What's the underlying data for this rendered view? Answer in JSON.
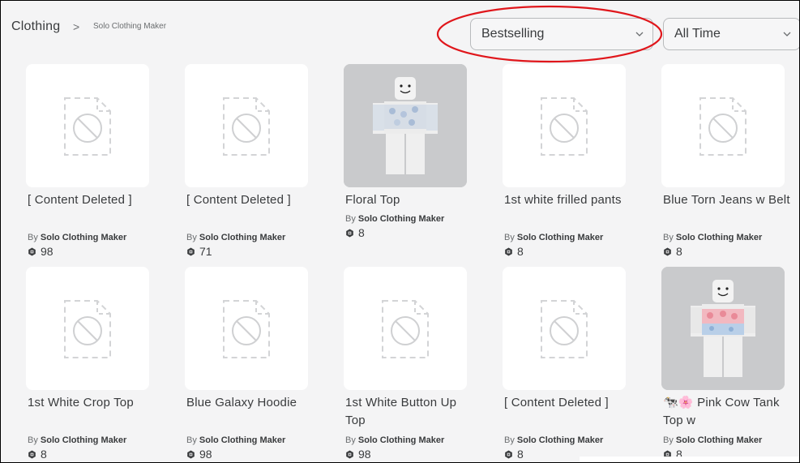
{
  "breadcrumb": {
    "category": "Clothing",
    "chevron": ">",
    "creator": "Solo Clothing Maker"
  },
  "filters": {
    "sort": {
      "value": "Bestselling",
      "highlighted": true
    },
    "time": {
      "value": "All Time"
    }
  },
  "items": [
    {
      "title": "[ Content Deleted ]",
      "creator_prefix": "By",
      "creator": "Solo Clothing Maker",
      "price": "98",
      "thumb": "deleted"
    },
    {
      "title": "[ Content Deleted ]",
      "creator_prefix": "By",
      "creator": "Solo Clothing Maker",
      "price": "71",
      "thumb": "deleted"
    },
    {
      "title": "Floral Top",
      "creator_prefix": "By",
      "creator": "Solo Clothing Maker",
      "price": "8",
      "thumb": "avatar-floral"
    },
    {
      "title": "1st white frilled pants",
      "creator_prefix": "By",
      "creator": "Solo Clothing Maker",
      "price": "8",
      "thumb": "deleted"
    },
    {
      "title": "Blue Torn Jeans w Belt",
      "creator_prefix": "By",
      "creator": "Solo Clothing Maker",
      "price": "8",
      "thumb": "deleted"
    },
    {
      "title": "1st White Crop Top",
      "creator_prefix": "By",
      "creator": "Solo Clothing Maker",
      "price": "8",
      "thumb": "deleted"
    },
    {
      "title": "Blue Galaxy Hoodie",
      "creator_prefix": "By",
      "creator": "Solo Clothing Maker",
      "price": "98",
      "thumb": "deleted"
    },
    {
      "title": "1st White Button Up Top",
      "creator_prefix": "By",
      "creator": "Solo Clothing Maker",
      "price": "98",
      "thumb": "deleted"
    },
    {
      "title": "[ Content Deleted ]",
      "creator_prefix": "By",
      "creator": "Solo Clothing Maker",
      "price": "8",
      "thumb": "deleted"
    },
    {
      "title": "🐄🌸 Pink Cow Tank Top w",
      "creator_prefix": "By",
      "creator": "Solo Clothing Maker",
      "price": "8",
      "thumb": "avatar-pinkcow"
    }
  ],
  "colors": {
    "highlight": "#e0161b",
    "background": "#f4f4f5",
    "text": "#393b3d",
    "muted": "#6b6e70"
  }
}
